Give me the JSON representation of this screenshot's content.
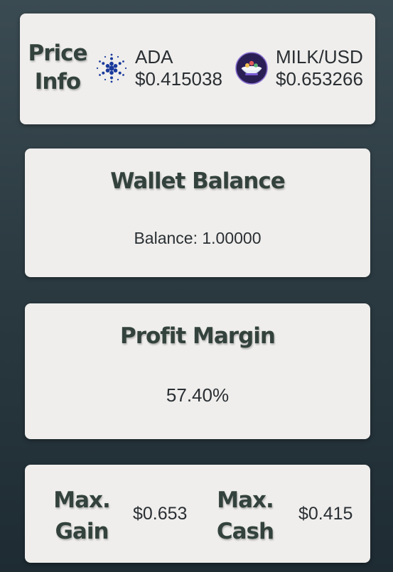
{
  "price_info": {
    "title_line1": "Price",
    "title_line2": "Info",
    "tokens": [
      {
        "symbol": "ADA",
        "price": "$0.415038",
        "icon": "cardano-logo-icon",
        "color": "#1a3a9c"
      },
      {
        "symbol": "MILK/USD",
        "price": "$0.653266",
        "icon": "milk-bowl-logo-icon",
        "color": "#2a1f55"
      }
    ]
  },
  "wallet": {
    "title": "Wallet Balance",
    "balance_text": "Balance: 1.00000"
  },
  "profit": {
    "title": "Profit Margin",
    "value": "57.40%"
  },
  "max": {
    "gain_label_line1": "Max.",
    "gain_label_line2": "Gain",
    "gain_value": "$0.653",
    "cash_label_line1": "Max.",
    "cash_label_line2": "Cash",
    "cash_value": "$0.415"
  }
}
